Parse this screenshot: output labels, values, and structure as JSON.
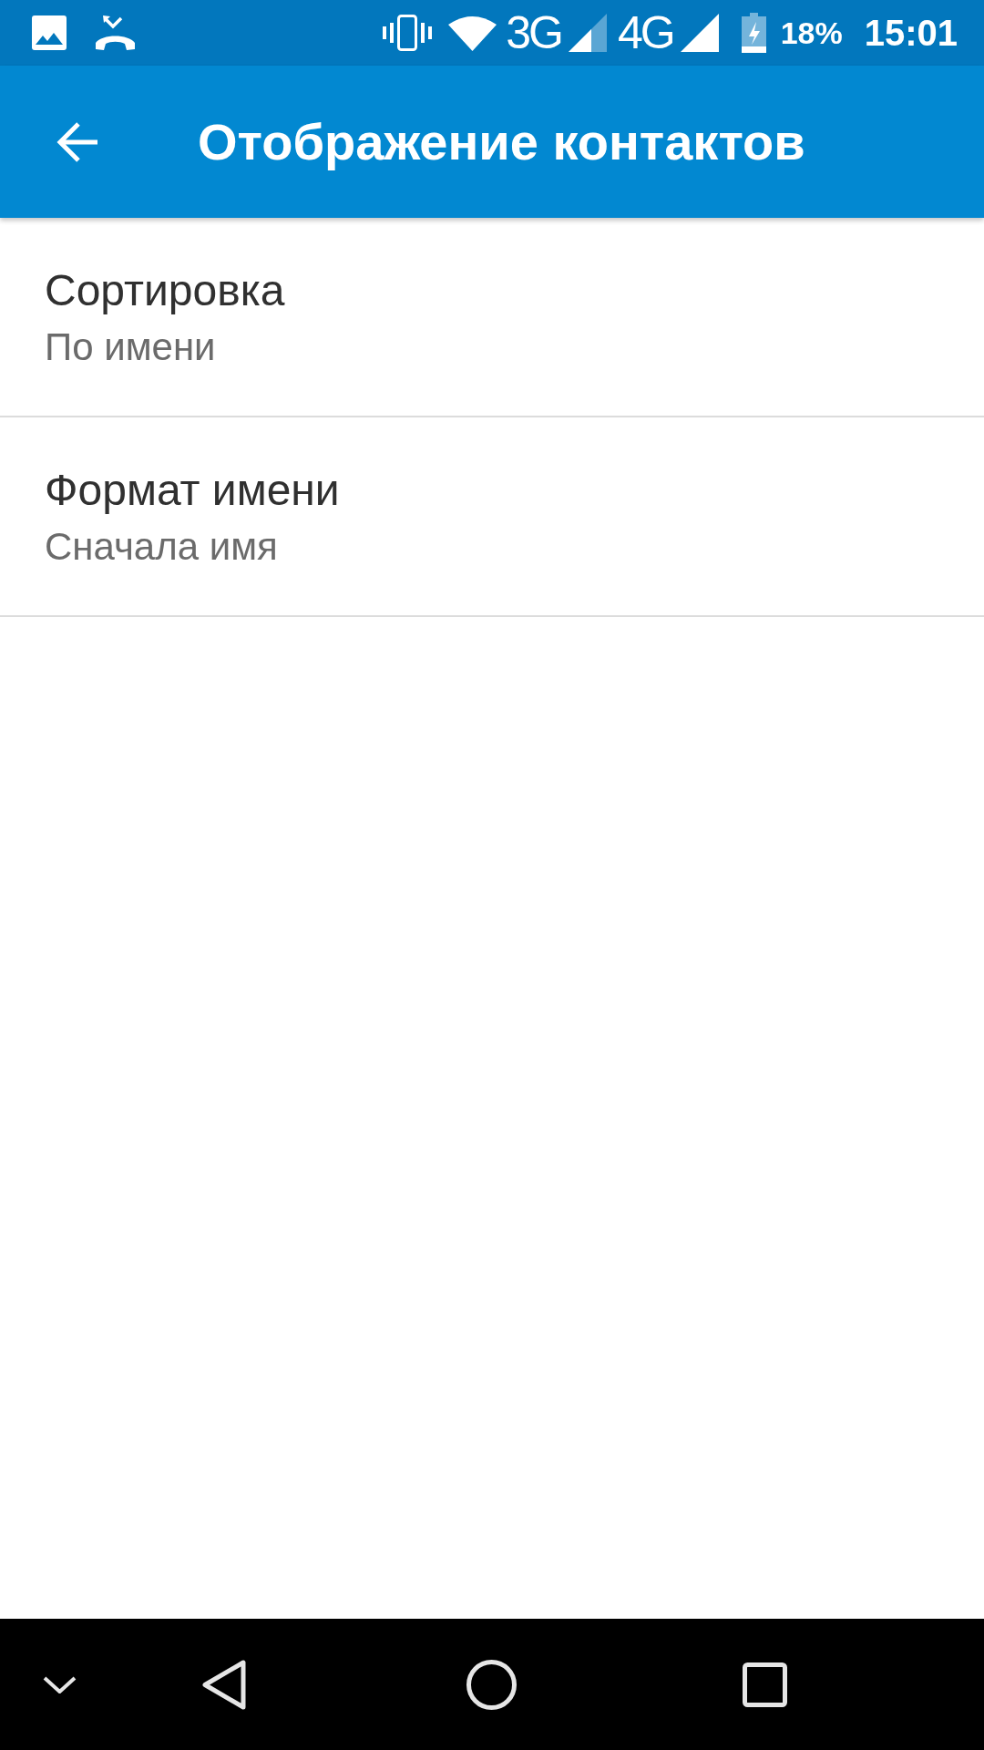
{
  "status_bar": {
    "network_type_1": "3G",
    "network_type_2": "4G",
    "battery": "18%",
    "time": "15:01"
  },
  "app_bar": {
    "title": "Отображение контактов"
  },
  "settings": [
    {
      "title": "Сортировка",
      "summary": "По имени"
    },
    {
      "title": "Формат имени",
      "summary": "Сначала имя"
    }
  ]
}
